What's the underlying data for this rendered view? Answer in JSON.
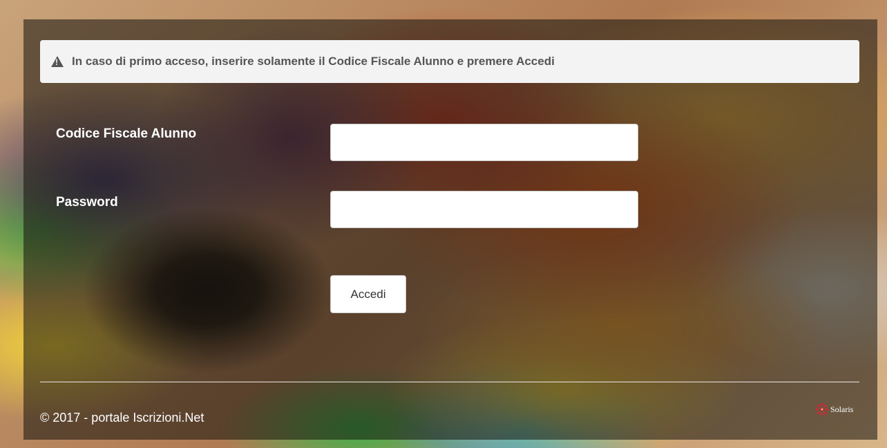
{
  "notice": {
    "text": "In caso di primo acceso, inserire solamente il Codice Fiscale Alunno e premere Accedi",
    "icon": "warning-icon"
  },
  "form": {
    "codice_fiscale_label": "Codice Fiscale Alunno",
    "codice_fiscale_value": "",
    "password_label": "Password",
    "password_value": "",
    "submit_label": "Accedi"
  },
  "footer": {
    "copyright": "© 2017 - portale Iscrizioni.Net",
    "brand": "Solaris",
    "brand_icon": "solaris-flower-icon",
    "brand_color": "#c0303a"
  }
}
